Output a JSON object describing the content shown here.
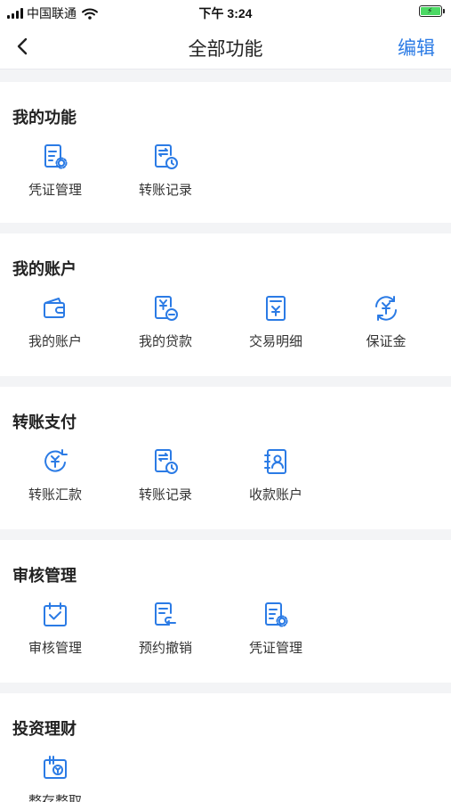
{
  "status": {
    "carrier": "中国联通",
    "time": "下午 3:24"
  },
  "nav": {
    "title": "全部功能",
    "edit": "编辑"
  },
  "sections": [
    {
      "title": "我的功能",
      "items": [
        {
          "label": "凭证管理",
          "icon": "doc-gear-icon"
        },
        {
          "label": "转账记录",
          "icon": "transfer-record-icon"
        }
      ]
    },
    {
      "title": "我的账户",
      "items": [
        {
          "label": "我的账户",
          "icon": "wallet-icon"
        },
        {
          "label": "我的贷款",
          "icon": "loan-icon"
        },
        {
          "label": "交易明细",
          "icon": "receipt-yen-icon"
        },
        {
          "label": "保证金",
          "icon": "yen-refresh-icon"
        }
      ]
    },
    {
      "title": "转账支付",
      "items": [
        {
          "label": "转账汇款",
          "icon": "yen-circle-icon"
        },
        {
          "label": "转账记录",
          "icon": "transfer-record-icon"
        },
        {
          "label": "收款账户",
          "icon": "contact-card-icon"
        }
      ]
    },
    {
      "title": "审核管理",
      "items": [
        {
          "label": "审核管理",
          "icon": "calendar-check-icon"
        },
        {
          "label": "预约撤销",
          "icon": "doc-undo-icon"
        },
        {
          "label": "凭证管理",
          "icon": "doc-gear-icon"
        }
      ]
    },
    {
      "title": "投资理财",
      "items": [
        {
          "label": "整存整取",
          "icon": "deposit-icon"
        }
      ]
    }
  ],
  "colors": {
    "accent": "#2b7be5",
    "background": "#f3f4f6"
  }
}
